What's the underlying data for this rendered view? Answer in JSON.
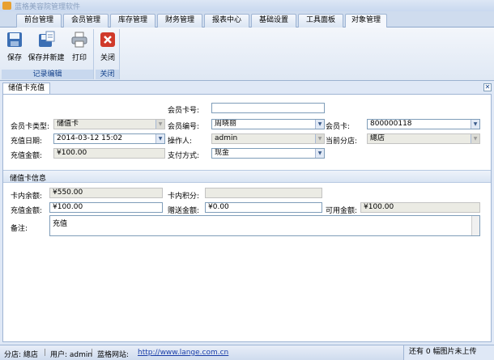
{
  "app": {
    "title": "蓝格美容院管理软件"
  },
  "tabs": [
    {
      "label": "前台管理"
    },
    {
      "label": "会员管理"
    },
    {
      "label": "库存管理"
    },
    {
      "label": "财务管理"
    },
    {
      "label": "报表中心"
    },
    {
      "label": "基础设置"
    },
    {
      "label": "工具面板"
    },
    {
      "label": "对象管理"
    }
  ],
  "active_tab": "对象管理",
  "ribbon": {
    "save": "保存",
    "save_new": "保存并新建",
    "print": "打印",
    "close": "关闭",
    "group_record": "记录编辑",
    "group_close": "关闭"
  },
  "doc_tab": {
    "label": "储值卡充值"
  },
  "form": {
    "card_no_label": "会员卡号:",
    "card_no_value": "",
    "card_type_label": "会员卡类型:",
    "card_type_value": "储值卡",
    "member_no_label": "会员编号:",
    "member_no_value": "周晓丽",
    "member_card_label": "会员卡:",
    "member_card_value": "800000118",
    "date_label": "充值日期:",
    "date_value": "2014-03-12 15:02",
    "operator_label": "操作人:",
    "operator_value": "admin",
    "branch_label": "当前分店:",
    "branch_value": "總店",
    "amount_label": "充值金额:",
    "amount_value": "¥100.00",
    "pay_label": "支付方式:",
    "pay_value": "现金"
  },
  "card_info": {
    "section": "储值卡信息",
    "balance_label": "卡内余额:",
    "balance_value": "¥550.00",
    "points_label": "卡内积分:",
    "points_value": "",
    "recharge_label": "充值金额:",
    "recharge_value": "¥100.00",
    "gift_label": "赠送金额:",
    "gift_value": "¥0.00",
    "usable_label": "可用金额:",
    "usable_value": "¥100.00",
    "remark_label": "备注:",
    "remark_value": "充值"
  },
  "status": {
    "branch": "分店: 總店",
    "user": "用户: admin",
    "site_label": "蓝格网站:",
    "site_url": "http://www.lange.com.cn",
    "right": "还有 0 幅图片未上传"
  },
  "colors": {
    "accent": "#15428b",
    "panel_bg": "#dfe8f6",
    "link": "#1a3ea8"
  }
}
